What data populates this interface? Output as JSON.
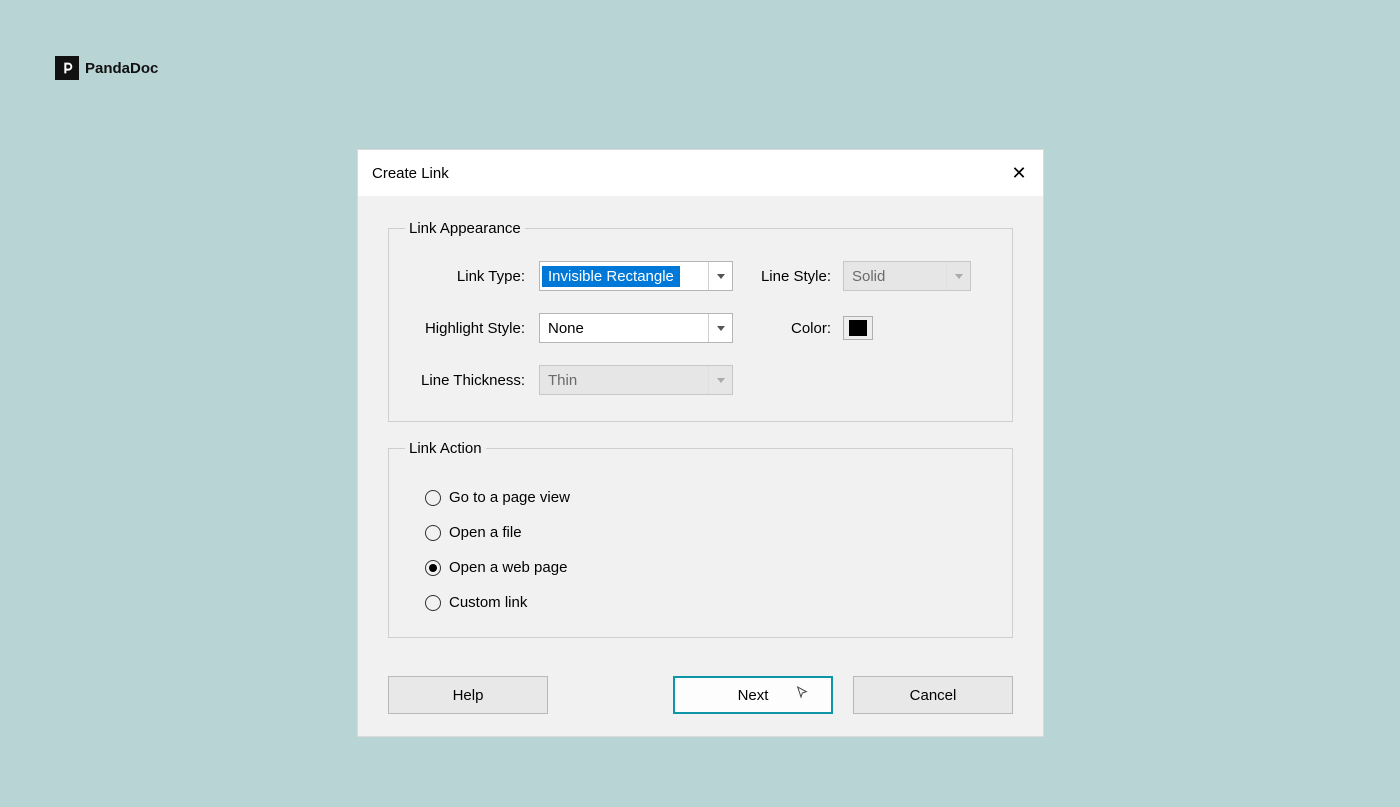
{
  "brand": {
    "name": "PandaDoc"
  },
  "dialog": {
    "title": "Create Link",
    "appearance": {
      "legend": "Link Appearance",
      "link_type_label": "Link Type:",
      "link_type_value": "Invisible Rectangle",
      "highlight_style_label": "Highlight Style:",
      "highlight_style_value": "None",
      "line_thickness_label": "Line Thickness:",
      "line_thickness_value": "Thin",
      "line_style_label": "Line Style:",
      "line_style_value": "Solid",
      "color_label": "Color:",
      "color_value": "#000000"
    },
    "action": {
      "legend": "Link Action",
      "options": [
        {
          "label": "Go to a page view",
          "selected": false
        },
        {
          "label": "Open a file",
          "selected": false
        },
        {
          "label": "Open a web page",
          "selected": true
        },
        {
          "label": "Custom link",
          "selected": false
        }
      ]
    },
    "buttons": {
      "help": "Help",
      "next": "Next",
      "cancel": "Cancel"
    }
  }
}
